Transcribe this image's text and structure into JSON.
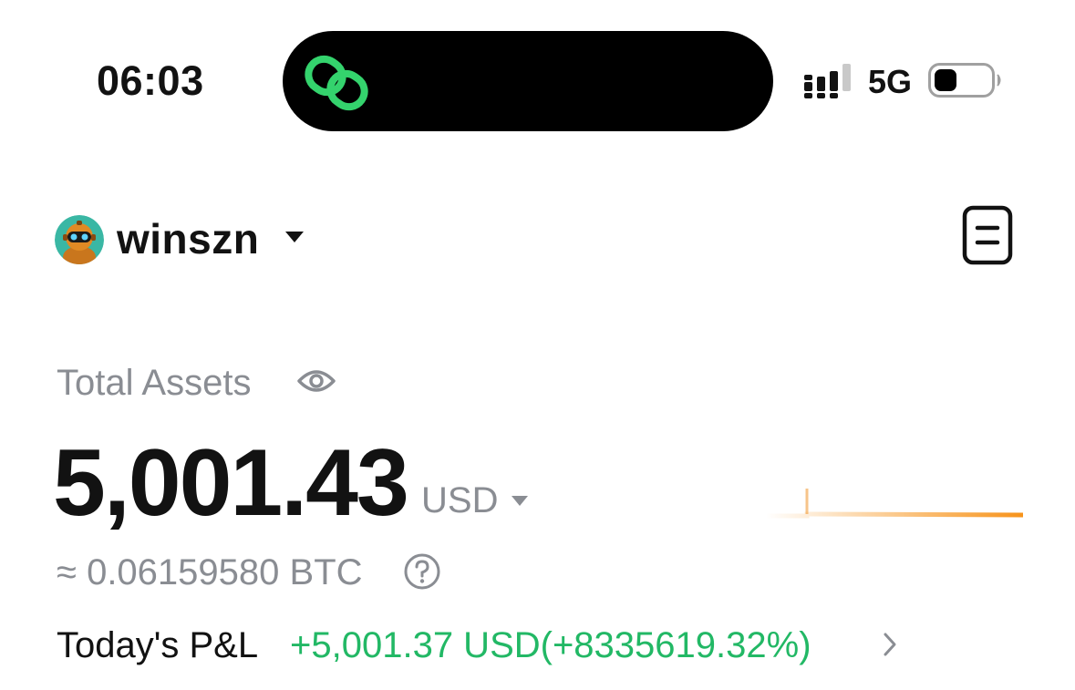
{
  "status_bar": {
    "time": "06:03",
    "network": "5G",
    "island_icon": "link-icon",
    "signal_icon": "cellular-signal-icon",
    "battery_icon": "battery-icon"
  },
  "account": {
    "name": "winszn",
    "avatar_icon": "robot-avatar",
    "caret_icon": "caret-down-icon",
    "action_icon": "document-icon"
  },
  "assets": {
    "label": "Total Assets",
    "visibility_icon": "eye-icon",
    "total": "5,001.43",
    "currency": "USD",
    "currency_caret_icon": "caret-down-icon",
    "btc_equivalent": "≈ 0.06159580 BTC",
    "help_icon": "question-circle-icon",
    "sparkline_color": "#f7931a"
  },
  "pnl": {
    "label": "Today's P&L",
    "value": "+5,001.37 USD(+8335619.32%)",
    "color": "#22b865",
    "chevron_icon": "chevron-right-icon"
  }
}
